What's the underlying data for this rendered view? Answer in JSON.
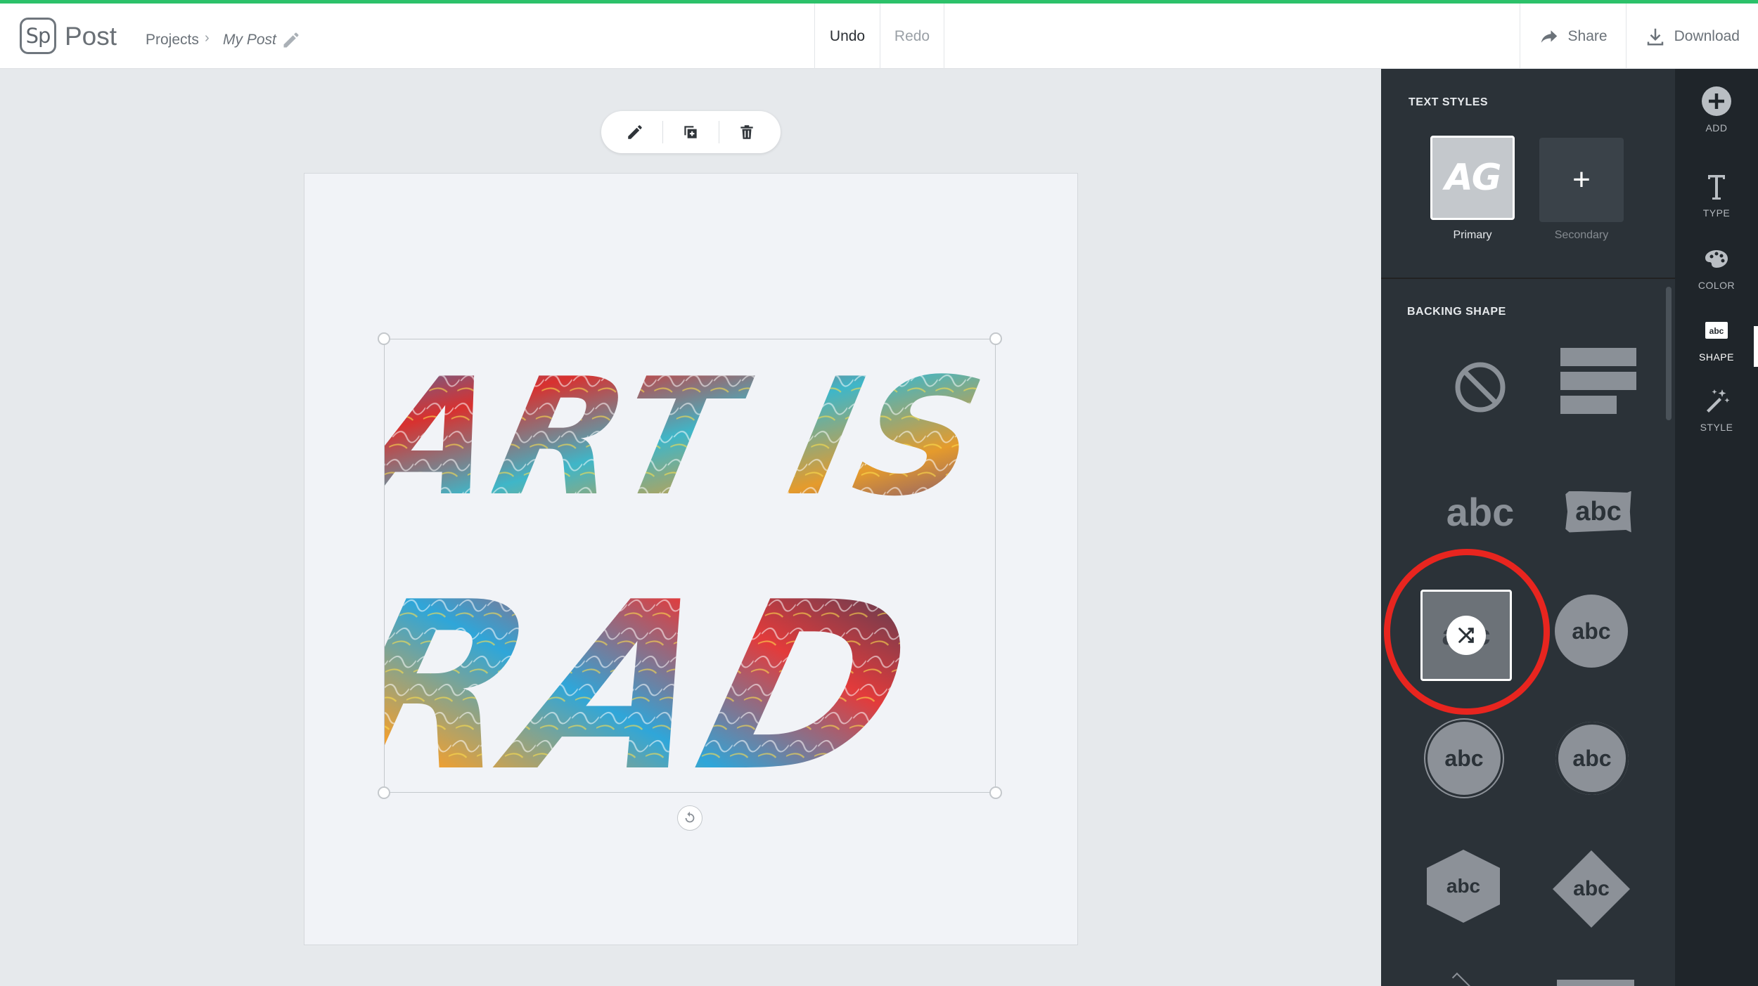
{
  "header": {
    "logo_text": "Sp",
    "app_name": "Post",
    "breadcrumb_projects": "Projects",
    "breadcrumb_separator": "›",
    "post_name": "My Post",
    "undo_label": "Undo",
    "redo_label": "Redo",
    "share_label": "Share",
    "download_label": "Download",
    "accent_color": "#2cc16a"
  },
  "canvas": {
    "headline_line1": "ART IS",
    "headline_line2": "RAD",
    "toolbar_icons": [
      "pencil-icon",
      "duplicate-icon",
      "trash-icon"
    ],
    "rotate_icon": "rotate-icon"
  },
  "panel": {
    "text_styles_title": "TEXT STYLES",
    "primary_preview": "AG",
    "primary_label": "Primary",
    "secondary_symbol": "+",
    "secondary_label": "Secondary",
    "backing_shape_title": "BACKING SHAPE",
    "shape_sample_text": "abc",
    "highlight_color": "#e8251f"
  },
  "rail": {
    "items": [
      {
        "label": "ADD",
        "icon": "plus-circle-icon"
      },
      {
        "label": "TYPE",
        "icon": "type-icon"
      },
      {
        "label": "COLOR",
        "icon": "palette-icon"
      },
      {
        "label": "SHAPE",
        "icon": "shape-icon"
      },
      {
        "label": "STYLE",
        "icon": "magic-wand-icon"
      }
    ]
  }
}
